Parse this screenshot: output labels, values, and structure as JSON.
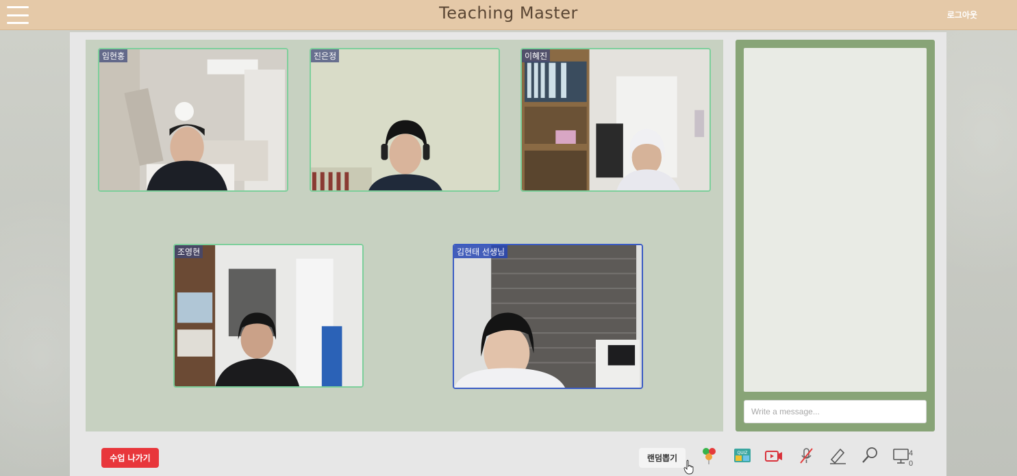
{
  "app": {
    "title": "Teaching Master",
    "logout_label": "로그아웃",
    "menu_icon": "hamburger-icon"
  },
  "colors": {
    "topbar": "#e5c9a8",
    "video_area": "#c7d1c1",
    "chat_frame": "#88a477",
    "student_border": "#7dcf9b",
    "teacher_border": "#3a5bc4",
    "leave_button": "#e8363b"
  },
  "participants": [
    {
      "name": "임현홍",
      "role": "student"
    },
    {
      "name": "진은정",
      "role": "student"
    },
    {
      "name": "이혜진",
      "role": "student"
    },
    {
      "name": "조영현",
      "role": "student"
    },
    {
      "name": "김현태 선생님",
      "role": "teacher"
    }
  ],
  "chat": {
    "placeholder": "Write a message...",
    "value": ""
  },
  "toolbar": {
    "leave_label": "수업 나가기",
    "random_label": "랜덤뽑기",
    "icons": [
      "balloon-vote-icon",
      "quiz-icon",
      "video-camera-icon",
      "microphone-muted-icon",
      "pen-annotate-icon",
      "magnifier-icon",
      "screen-share-icon"
    ],
    "count_top": "4",
    "count_bottom": "0"
  }
}
